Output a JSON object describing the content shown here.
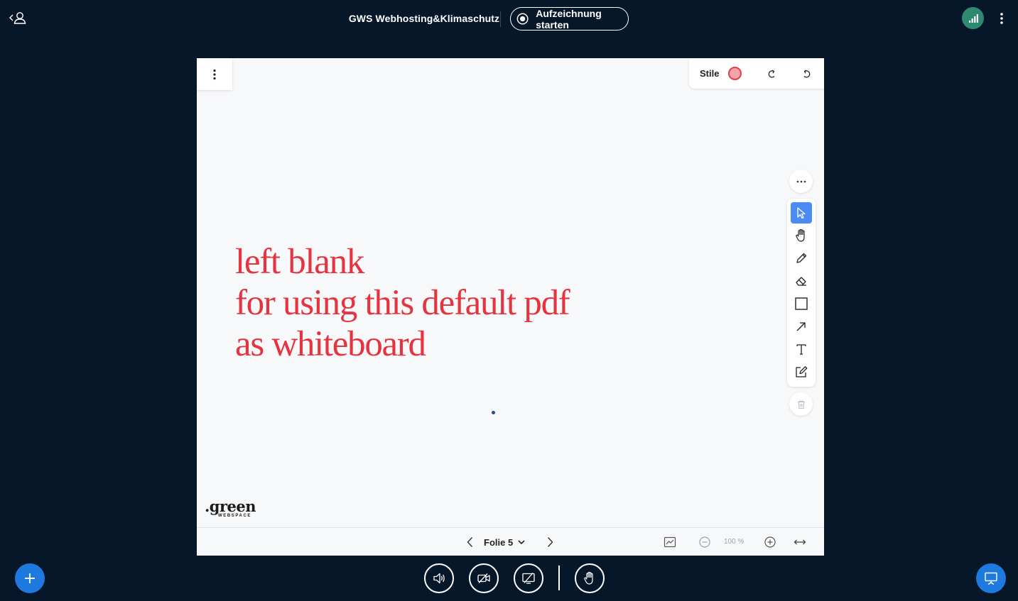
{
  "header": {
    "meeting_title": "GWS Webhosting&Klimaschutz",
    "record_label": "Aufzeichnung starten",
    "icons": {
      "user_toggle": "user-list-icon",
      "connection": "signal-bars-icon",
      "options": "vertical-dots-icon"
    }
  },
  "whiteboard": {
    "style_label": "Stile",
    "style_color": "#e03e48",
    "slide_text": [
      "left blank",
      "for using this default pdf",
      "as whiteboard"
    ],
    "text_color": "#e5343f",
    "logo": {
      "main": ".green",
      "sub": "WEBSPACE"
    },
    "tools": [
      "select",
      "pan",
      "pencil",
      "eraser",
      "rectangle",
      "arrow",
      "text",
      "note"
    ],
    "active_tool": "select"
  },
  "slide_nav": {
    "slide_label": "Folie 5",
    "zoom": "100 %"
  },
  "colors": {
    "background": "#06172a",
    "accent": "#1f7ae0",
    "tool_active": "#4a8af4",
    "connection_ok": "#2e8a6e"
  }
}
